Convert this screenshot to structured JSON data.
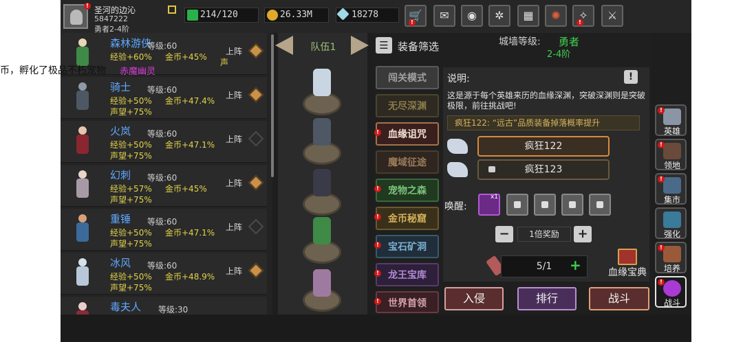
{
  "player": {
    "name": "圣河的边沁",
    "id": "5847222",
    "rank": "勇者2-4阶"
  },
  "resources": {
    "energy": "214/120",
    "gold": "26.33M",
    "gems": "18278"
  },
  "overlay": {
    "text": "币，孵化了极品不朽宠物",
    "highlight": "赤魔幽灵"
  },
  "heroes": [
    {
      "name": "森林游侠",
      "level_label": "等级:60",
      "exp": "经验+60%",
      "gold": "金币+45%",
      "fame": "声",
      "deploy": "上阵",
      "deployed": true
    },
    {
      "name": "骑士",
      "level_label": "等级:60",
      "exp": "经验+50%",
      "gold": "金币+47.4%",
      "fame": "声望+75%",
      "deploy": "上阵",
      "deployed": true
    },
    {
      "name": "火岚",
      "level_label": "等级:60",
      "exp": "经验+50%",
      "gold": "金币+47.1%",
      "fame": "声望+75%",
      "deploy": "上阵",
      "deployed": false
    },
    {
      "name": "幻刺",
      "level_label": "等级:60",
      "exp": "经验+57%",
      "gold": "金币+45%",
      "fame": "声望+75%",
      "deploy": "上阵",
      "deployed": true
    },
    {
      "name": "重锤",
      "level_label": "等级:60",
      "exp": "经验+50%",
      "gold": "金币+47.1%",
      "fame": "声望+75%",
      "deploy": "上阵",
      "deployed": false
    },
    {
      "name": "冰风",
      "level_label": "等级:60",
      "exp": "经验+50%",
      "gold": "金币+48.9%",
      "fame": "声望+75%",
      "deploy": "上阵",
      "deployed": true
    },
    {
      "name": "毒夫人",
      "level_label": "等级:30",
      "exp": "",
      "gold": "",
      "fame": "",
      "deploy": "",
      "deployed": false
    }
  ],
  "team": {
    "title": "队伍1"
  },
  "filter": {
    "label": "装备筛选"
  },
  "wall": {
    "label": "城墙等级:",
    "value": "勇者",
    "sub": "2-4阶"
  },
  "modes": [
    {
      "label": "闯关模式",
      "badge": false
    },
    {
      "label": "无尽深渊",
      "badge": false
    },
    {
      "label": "血缘诅咒",
      "badge": true
    },
    {
      "label": "魔域征途",
      "badge": false
    },
    {
      "label": "宠物之森",
      "badge": true
    },
    {
      "label": "金币秘窟",
      "badge": true
    },
    {
      "label": "宝石矿洞",
      "badge": true
    },
    {
      "label": "龙王宝库",
      "badge": true
    },
    {
      "label": "世界首领",
      "badge": true
    }
  ],
  "description": {
    "title": "说明:",
    "text": "这是源于每个英雄来历的血缘深渊，突破深渊则是突破极限，前往挑战吧!",
    "hint": "疯狂122: “远古”品质装备掉落概率提升"
  },
  "difficulty": {
    "selected": "疯狂122",
    "locked": "疯狂123"
  },
  "awaken": {
    "label": "唤醒:",
    "slot_badge": "x1"
  },
  "reward": {
    "minus": "−",
    "label": "1倍奖励",
    "plus": "+"
  },
  "keys": {
    "count": "5/1",
    "plus": "+"
  },
  "book": {
    "label": "血缘宝典"
  },
  "actions": {
    "invade": "入侵",
    "rank": "排行",
    "battle": "战斗"
  },
  "nav": [
    {
      "label": "英雄",
      "icon": "helmet-icon"
    },
    {
      "label": "领地",
      "icon": "castle-icon"
    },
    {
      "label": "集市",
      "icon": "market-icon"
    },
    {
      "label": "强化",
      "icon": "forge-icon"
    },
    {
      "label": "培养",
      "icon": "potion-icon"
    },
    {
      "label": "战斗",
      "icon": "portal-icon"
    }
  ],
  "colors": {
    "name_blue": "#5fa8ff",
    "stat_yellow": "#e2d34a",
    "wall_green": "#3fd14e",
    "badge_red": "#d01818",
    "action_pink": "#d8a0a0",
    "selected_orange": "#d88b3c"
  }
}
